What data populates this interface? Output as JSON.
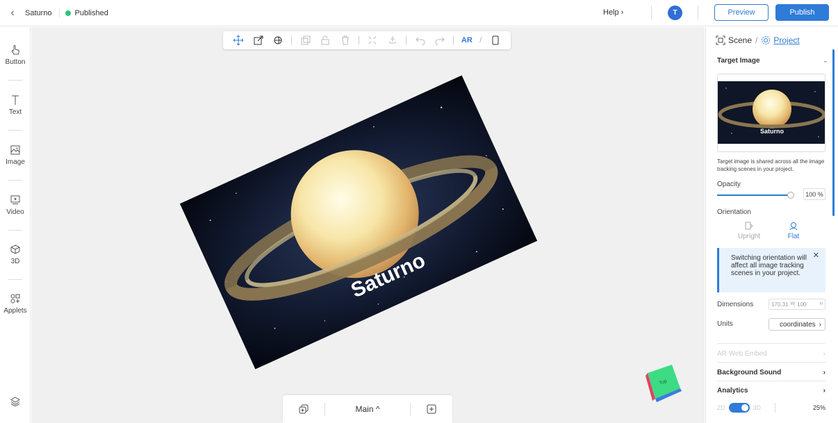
{
  "topbar": {
    "project_name": "Saturno",
    "status": "Published",
    "help": "Help ›",
    "avatar_initial": "T",
    "preview": "Preview",
    "publish": "Publish"
  },
  "sidebar": {
    "items": [
      {
        "label": "Button",
        "icon": "pointer-hand-icon"
      },
      {
        "label": "Text",
        "icon": "text-icon"
      },
      {
        "label": "Image",
        "icon": "image-icon"
      },
      {
        "label": "Video",
        "icon": "video-icon"
      },
      {
        "label": "3D",
        "icon": "cube-icon"
      },
      {
        "label": "Applets",
        "icon": "applets-icon"
      }
    ],
    "layers_icon": "layers-icon"
  },
  "canvas_toolbar": {
    "ar_label": "AR",
    "slash": "/"
  },
  "target_image": {
    "label": "Saturno"
  },
  "bottom_bar": {
    "scene_name": "Main ^"
  },
  "cube": {
    "face_label": "Top"
  },
  "panel": {
    "tab_scene": "Scene",
    "tab_project": "Project",
    "tab_separator": "/",
    "target_image_title": "Target Image",
    "thumb_label": "Saturno",
    "note": "Target image is shared across all the image tracking scenes in your project.",
    "opacity_label": "Opacity",
    "opacity_value": "100 %",
    "opacity_fraction": 1.0,
    "orientation_label": "Orientation",
    "orientation_upright": "Upright",
    "orientation_flat": "Flat",
    "info_text": "Switching orientation will affect all image tracking scenes in your project.",
    "dimensions_label": "Dimensions",
    "dim_w_value": "170.31",
    "dim_w_unit": "W",
    "dim_h_value": "100",
    "dim_h_unit": "H",
    "units_label": "Units",
    "units_value": "coordinates",
    "ar_web_embed": "AR Web Embed",
    "background_sound": "Background Sound",
    "analytics": "Analytics",
    "toggle_2d": "2D",
    "toggle_3d": "3D",
    "zoom": "25%"
  },
  "colors": {
    "accent": "#2f7bd8",
    "published_dot": "#2ec27e"
  }
}
